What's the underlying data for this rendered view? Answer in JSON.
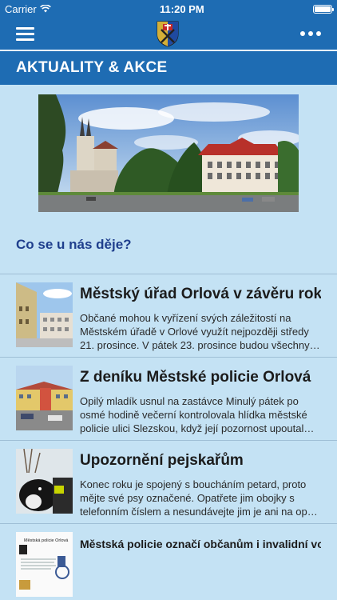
{
  "status": {
    "carrier": "Carrier",
    "time": "11:20 PM"
  },
  "header": {
    "menu_icon": "hamburger-menu-icon",
    "logo": "city-crest-logo",
    "more_icon": "more-dots-icon"
  },
  "section": {
    "title": "AKTUALITY & AKCE"
  },
  "subheading": "Co se u nás děje?",
  "news": [
    {
      "title": "Městský úřad Orlová v závěru roku",
      "desc": "Občané mohou k vyřízení svých záležitostí na Městském úřadě v Orlové využít nejpozději středy 21. prosince. V pátek 23. prosince budou všechny…"
    },
    {
      "title": "Z deníku Městské policie Orlová",
      "desc": "Opilý mladík usnul na zastávce  Minulý pátek po osmé hodině večerní kontrolovala hlídka městské policie ulici Slezskou, když její pozornost upoutal…"
    },
    {
      "title": "Upozornění pejskařům",
      "desc": "Konec roku je spojený s boucháním petard, proto mějte své psy označené. Opatřete jim obojky s telefonním číslem a nesundávejte jim je ani na op…"
    },
    {
      "title": "Městská policie označí občanům i invalidní vozíky",
      "desc": "",
      "thumb_caption": "Městská policie Orlová"
    }
  ]
}
